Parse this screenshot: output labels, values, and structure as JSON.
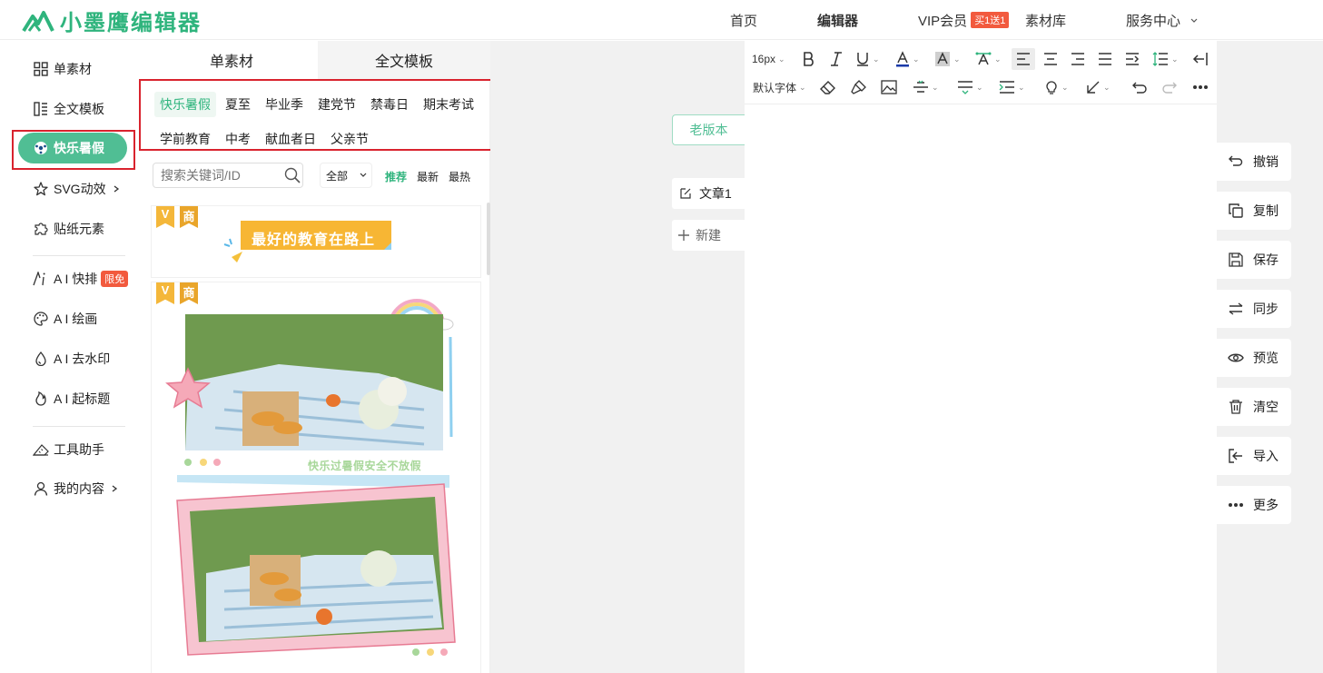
{
  "header": {
    "logo_text": "小墨鹰编辑器",
    "nav": [
      "首页",
      "编辑器",
      "VIP会员",
      "素材库",
      "服务中心"
    ],
    "vip_badge": "买1送1"
  },
  "sidebar": {
    "items": [
      {
        "label": "单素材",
        "icon": "grid-icon"
      },
      {
        "label": "全文模板",
        "icon": "template-icon"
      },
      {
        "label": "快乐暑假",
        "icon": "ball-icon"
      },
      {
        "label": "SVG动效",
        "icon": "star-icon"
      },
      {
        "label": "贴纸元素",
        "icon": "puzzle-icon"
      },
      {
        "label": "A I 快排",
        "icon": "ai-icon",
        "badge": "限免"
      },
      {
        "label": "A I 绘画",
        "icon": "palette-icon"
      },
      {
        "label": "A I 去水印",
        "icon": "drop-icon"
      },
      {
        "label": "A I 起标题",
        "icon": "fire-icon"
      },
      {
        "label": "工具助手",
        "icon": "ruler-icon"
      },
      {
        "label": "我的内容",
        "icon": "user-icon"
      }
    ]
  },
  "panel": {
    "tabs": [
      "单素材",
      "全文模板"
    ],
    "categories": [
      "快乐暑假",
      "夏至",
      "毕业季",
      "建党节",
      "禁毒日",
      "期末考试",
      "学前教育",
      "中考",
      "献血者日",
      "父亲节"
    ],
    "search_placeholder": "搜索关键词/ID",
    "filter": "全部",
    "sorts": [
      "推荐",
      "最新",
      "最热"
    ],
    "card1": {
      "tag_v": "V",
      "tag_s": "商",
      "banner": "最好的教育在路上"
    },
    "card2": {
      "tag_v": "V",
      "tag_s": "商",
      "caption": "快乐过暑假安全不放假"
    }
  },
  "canvas": {
    "old_version": "老版本",
    "doc_tab": "文章1",
    "new_tab": "新建"
  },
  "toolbar": {
    "font_size": "16px",
    "font_family": "默认字体"
  },
  "actions": [
    "撤销",
    "复制",
    "保存",
    "同步",
    "预览",
    "清空",
    "导入",
    "更多"
  ]
}
